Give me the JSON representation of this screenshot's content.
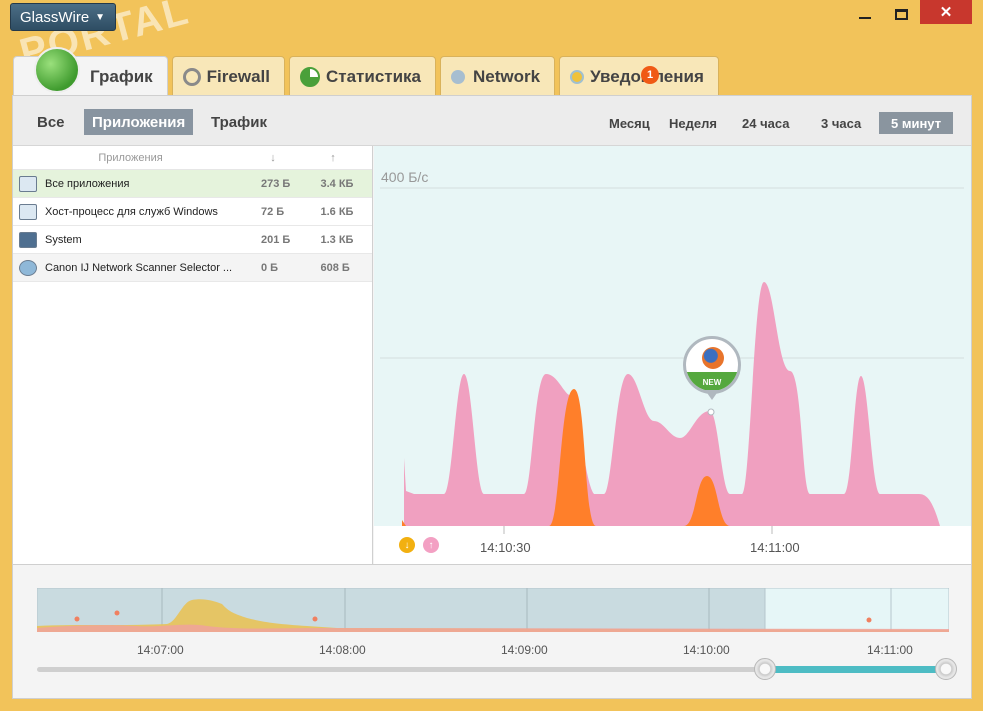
{
  "app": {
    "title": "GlassWire",
    "watermark": "PORTAL"
  },
  "window": {
    "close_glyph": "✕"
  },
  "tabs": [
    {
      "label": "График",
      "icon": "graph-icon"
    },
    {
      "label": "Firewall",
      "icon": "firewall-icon"
    },
    {
      "label": "Статистика",
      "icon": "stats-icon"
    },
    {
      "label": "Network",
      "icon": "network-icon"
    },
    {
      "label": "Уведомления",
      "icon": "alert-icon",
      "badge": "1"
    }
  ],
  "filters": {
    "all": "Все",
    "apps": "Приложения",
    "traffic": "Трафик"
  },
  "ranges": {
    "month": "Месяц",
    "week": "Неделя",
    "day": "24 часа",
    "three": "3 часа",
    "five": "5 минут"
  },
  "apps_table": {
    "header": {
      "name": "Приложения",
      "down": "↓",
      "up": "↑"
    },
    "rows": [
      {
        "name": "Все приложения",
        "down": "273 Б",
        "up": "3.4 КБ"
      },
      {
        "name": "Хост-процесс для служб Windows",
        "down": "72 Б",
        "up": "1.6 КБ"
      },
      {
        "name": "System",
        "down": "201 Б",
        "up": "1.3 КБ"
      },
      {
        "name": "Canon IJ Network Scanner Selector ...",
        "down": "0 Б",
        "up": "608 Б"
      }
    ]
  },
  "chart": {
    "ylabel": "400 Б/с",
    "xlabels": [
      "14:10:30",
      "14:11:00"
    ],
    "legend": {
      "down": "↓",
      "up": "↑"
    },
    "pin_label": "NEW"
  },
  "timeline": {
    "labels": [
      "14:07:00",
      "14:08:00",
      "14:09:00",
      "14:10:00",
      "14:11:00"
    ]
  },
  "colors": {
    "upload": "#f09bbd",
    "download": "#ff7f2a",
    "accent": "#4dbcc4",
    "window": "#f2c35a"
  }
}
